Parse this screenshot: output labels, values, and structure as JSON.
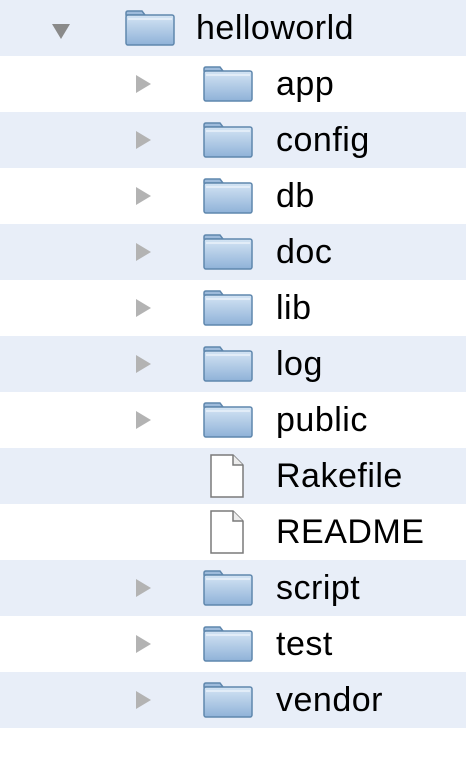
{
  "tree": {
    "root": {
      "label": "helloworld",
      "expanded": true,
      "icon": "folder-icon"
    },
    "items": [
      {
        "label": "app",
        "type": "folder",
        "icon": "folder-icon",
        "expanded": false
      },
      {
        "label": "config",
        "type": "folder",
        "icon": "folder-icon",
        "expanded": false
      },
      {
        "label": "db",
        "type": "folder",
        "icon": "folder-icon",
        "expanded": false
      },
      {
        "label": "doc",
        "type": "folder",
        "icon": "folder-icon",
        "expanded": false
      },
      {
        "label": "lib",
        "type": "folder",
        "icon": "folder-icon",
        "expanded": false
      },
      {
        "label": "log",
        "type": "folder",
        "icon": "folder-icon",
        "expanded": false
      },
      {
        "label": "public",
        "type": "folder",
        "icon": "folder-icon",
        "expanded": false
      },
      {
        "label": "Rakefile",
        "type": "file",
        "icon": "document-icon"
      },
      {
        "label": "README",
        "type": "file",
        "icon": "document-icon"
      },
      {
        "label": "script",
        "type": "folder",
        "icon": "folder-icon",
        "expanded": false
      },
      {
        "label": "test",
        "type": "folder",
        "icon": "folder-icon",
        "expanded": false
      },
      {
        "label": "vendor",
        "type": "folder",
        "icon": "folder-icon",
        "expanded": false
      }
    ]
  },
  "colors": {
    "row_alt": "#e8eef8",
    "folder_body": "#a9c6e4",
    "folder_border": "#5f87ad",
    "disclosure": "#b3b3b3"
  }
}
